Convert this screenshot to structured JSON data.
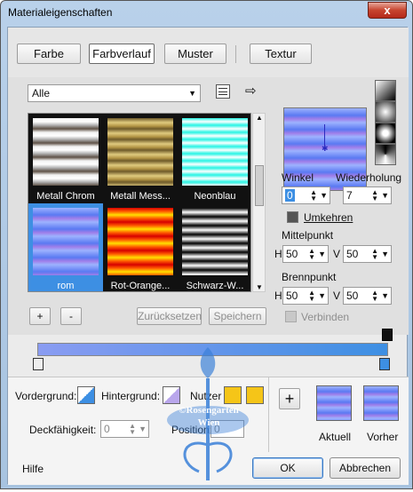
{
  "window": {
    "title": "Materialeigenschaften",
    "close_label": "x"
  },
  "tabs": [
    {
      "label": "Farbe",
      "active": false
    },
    {
      "label": "Farbverlauf",
      "active": true
    },
    {
      "label": "Muster",
      "active": false
    },
    {
      "label": "Textur",
      "active": false
    }
  ],
  "category": {
    "value": "Alle"
  },
  "gradients": [
    {
      "name": "Metall Chrom",
      "selected": false
    },
    {
      "name": "Metall Mess...",
      "selected": false
    },
    {
      "name": "Neonblau",
      "selected": false
    },
    {
      "name": "rom",
      "selected": true
    },
    {
      "name": "Rot-Orange...",
      "selected": false
    },
    {
      "name": "Schwarz-W...",
      "selected": false
    }
  ],
  "list_buttons": {
    "add": "+",
    "remove": "-",
    "reset": "Zurücksetzen",
    "save": "Speichern"
  },
  "angle": {
    "label": "Winkel",
    "value": "0"
  },
  "repeat": {
    "label": "Wiederholung",
    "value": "7"
  },
  "invert": {
    "label": "Umkehren"
  },
  "center": {
    "label": "Mittelpunkt",
    "h_label": "H",
    "h_value": "50",
    "v_label": "V",
    "v_value": "50"
  },
  "focus": {
    "label": "Brennpunkt",
    "h_label": "H",
    "h_value": "50",
    "v_label": "V",
    "v_value": "50"
  },
  "link": {
    "label": "Verbinden"
  },
  "colors": {
    "foreground_label": "Vordergrund:",
    "background_label": "Hintergrund:",
    "user_label": "Nutzer",
    "opacity_label": "Deckfähigkeit:",
    "opacity_value": "0",
    "position_label": "Position:",
    "position_value": "0",
    "foreground_color": "#3d8fe3",
    "background_color": "#b9a6ec",
    "user_color": "#f5c518"
  },
  "current": {
    "add": "+",
    "current_label": "Aktuell",
    "previous_label": "Vorher"
  },
  "footer": {
    "help": "Hilfe",
    "ok": "OK",
    "cancel": "Abbrechen"
  },
  "watermark": {
    "line1": "©Rosengarten",
    "line2": "Wien"
  }
}
